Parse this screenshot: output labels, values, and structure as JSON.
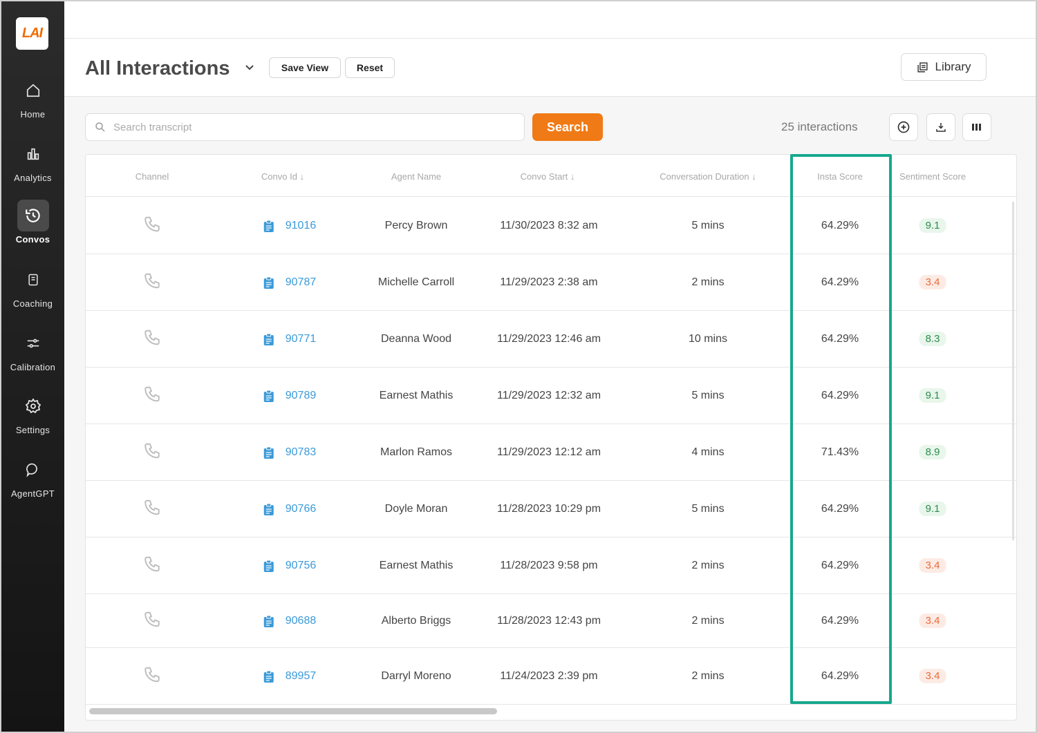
{
  "sidebar": {
    "logo_text": "LAI",
    "items": [
      {
        "label": "Home",
        "icon": "home-icon"
      },
      {
        "label": "Analytics",
        "icon": "bar-chart-icon"
      },
      {
        "label": "Convos",
        "icon": "history-icon",
        "active": true
      },
      {
        "label": "Coaching",
        "icon": "document-icon"
      },
      {
        "label": "Calibration",
        "icon": "sliders-icon"
      },
      {
        "label": "Settings",
        "icon": "gear-icon"
      },
      {
        "label": "AgentGPT",
        "icon": "chat-bubble-icon"
      }
    ]
  },
  "header": {
    "title": "All Interactions",
    "save_view_label": "Save View",
    "reset_label": "Reset",
    "library_label": "Library"
  },
  "toolbar": {
    "search_placeholder": "Search transcript",
    "search_value": "",
    "search_button_label": "Search",
    "count_text": "25 interactions"
  },
  "table": {
    "columns": {
      "channel": "Channel",
      "convo_id": "Convo Id ↓",
      "agent_name": "Agent Name",
      "convo_start": "Convo Start ↓",
      "duration": "Conversation Duration ↓",
      "insta_score": "Insta Score",
      "sentiment_score": "Sentiment Score"
    },
    "rows": [
      {
        "convo_id": "91016",
        "agent": "Percy Brown",
        "start": "11/30/2023 8:32 am",
        "duration": "5 mins",
        "insta": "64.29%",
        "sentiment": "9.1",
        "sentiment_level": "good"
      },
      {
        "convo_id": "90787",
        "agent": "Michelle Carroll",
        "start": "11/29/2023 2:38 am",
        "duration": "2 mins",
        "insta": "64.29%",
        "sentiment": "3.4",
        "sentiment_level": "bad"
      },
      {
        "convo_id": "90771",
        "agent": "Deanna Wood",
        "start": "11/29/2023 12:46 am",
        "duration": "10 mins",
        "insta": "64.29%",
        "sentiment": "8.3",
        "sentiment_level": "good"
      },
      {
        "convo_id": "90789",
        "agent": "Earnest Mathis",
        "start": "11/29/2023 12:32 am",
        "duration": "5 mins",
        "insta": "64.29%",
        "sentiment": "9.1",
        "sentiment_level": "good"
      },
      {
        "convo_id": "90783",
        "agent": "Marlon Ramos",
        "start": "11/29/2023 12:12 am",
        "duration": "4 mins",
        "insta": "71.43%",
        "sentiment": "8.9",
        "sentiment_level": "good"
      },
      {
        "convo_id": "90766",
        "agent": "Doyle Moran",
        "start": "11/28/2023 10:29 pm",
        "duration": "5 mins",
        "insta": "64.29%",
        "sentiment": "9.1",
        "sentiment_level": "good"
      },
      {
        "convo_id": "90756",
        "agent": "Earnest Mathis",
        "start": "11/28/2023 9:58 pm",
        "duration": "2 mins",
        "insta": "64.29%",
        "sentiment": "3.4",
        "sentiment_level": "bad"
      },
      {
        "convo_id": "90688",
        "agent": "Alberto Briggs",
        "start": "11/28/2023 12:43 pm",
        "duration": "2 mins",
        "insta": "64.29%",
        "sentiment": "3.4",
        "sentiment_level": "bad"
      },
      {
        "convo_id": "89957",
        "agent": "Darryl Moreno",
        "start": "11/24/2023 2:39 pm",
        "duration": "2 mins",
        "insta": "64.29%",
        "sentiment": "3.4",
        "sentiment_level": "bad"
      }
    ]
  },
  "colors": {
    "accent": "#f07a16",
    "link": "#3a9ad9",
    "highlight": "#16a88e",
    "good": "#2e8b4a",
    "bad": "#e86b3a"
  }
}
